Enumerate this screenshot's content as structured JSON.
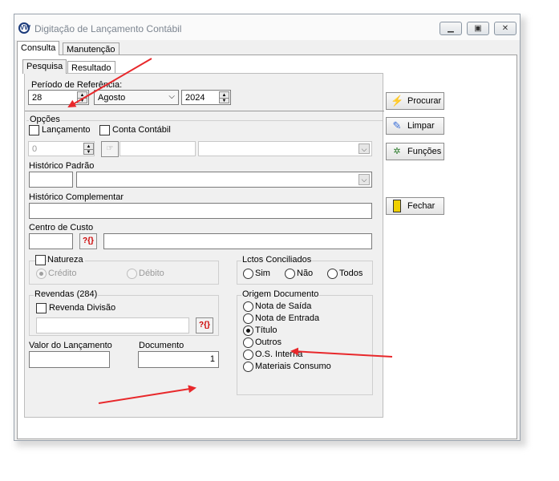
{
  "window": {
    "title": "Digitação de Lançamento Contábil",
    "logo": "VW",
    "controls": [
      "minimize",
      "maximize",
      "close"
    ]
  },
  "tabs": {
    "main": [
      "Consulta",
      "Manutenção"
    ],
    "sub": [
      "Pesquisa",
      "Resultado"
    ]
  },
  "periodo": {
    "label": "Período de Referência:",
    "day": "28",
    "month": "Agosto",
    "year": "2024"
  },
  "opcoes": {
    "legend": "Opções",
    "lancamento_label": "Lançamento",
    "conta_contabil_label": "Conta Contábil",
    "lancamento_value": "0"
  },
  "historico_padrao": {
    "label": "Histórico Padrão"
  },
  "historico_complementar": {
    "label": "Histórico Complementar"
  },
  "centro_custo": {
    "label": "Centro de Custo",
    "lookup_icon": "?{}"
  },
  "natureza": {
    "label": "Natureza",
    "options": [
      "Crédito",
      "Débito"
    ],
    "selected": "Crédito"
  },
  "lctos_conciliados": {
    "legend": "Lctos Conciliados",
    "options": [
      "Sim",
      "Não",
      "Todos"
    ]
  },
  "revendas": {
    "legend": "Revendas (284)",
    "divisao_label": "Revenda Divisão",
    "lookup_icon": "?{}"
  },
  "origem_documento": {
    "legend": "Origem Documento",
    "options": [
      "Nota de Saída",
      "Nota de Entrada",
      "Título",
      "Outros",
      "O.S. Interna",
      "Materiais Consumo"
    ],
    "selected": "Título"
  },
  "valor_lancamento": {
    "label": "Valor do Lançamento",
    "value": ""
  },
  "documento": {
    "label": "Documento",
    "value": "1"
  },
  "buttons": {
    "procurar": "Procurar",
    "limpar": "Limpar",
    "funcoes": "Funções",
    "fechar": "Fechar"
  },
  "colors": {
    "annotation_arrow": "#e8282b"
  }
}
